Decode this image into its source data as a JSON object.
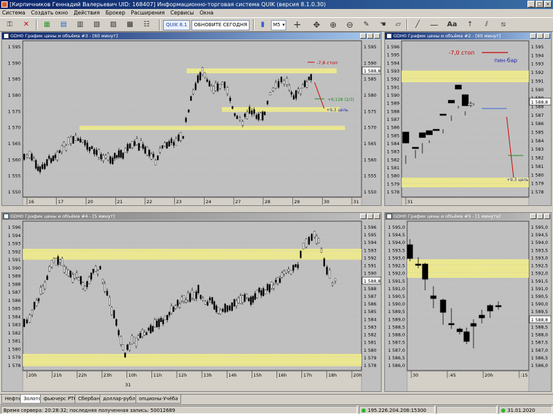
{
  "window": {
    "title": "[Кирпичников Геннадий Валерьевич UID: 168407] Информационно-торговая система QUIK (версия 8.1.0.30)"
  },
  "menu": [
    "Система",
    "Создать окно",
    "Действия",
    "Брокер",
    "Расширения",
    "Сервисы",
    "Окна"
  ],
  "toolbar": {
    "quik_label": "QUIK 8.1",
    "update_label": "ОБНОВИТЕ СЕГОДНЯ",
    "interval": "M5",
    "font_label": "Aa"
  },
  "colors": {
    "candle_up": "#ffffff",
    "candle_down": "#000000",
    "zone": "#f0eb8c",
    "stop": "#cc0000",
    "target": "#228822",
    "buy_line": "#3366cc"
  },
  "charts": [
    {
      "title": "GDH0 График цены и объёма #3 - [60 минут]",
      "yticks": [
        "1 595",
        "1 590",
        "1 585",
        "1 580",
        "1 575",
        "1 570",
        "1 565",
        "1 560",
        "1 555",
        "1 550"
      ],
      "yticks_right": [
        "1 595",
        "1 590",
        "1 585",
        "1 580",
        "1 575",
        "1 570",
        "1 565",
        "1 560",
        "1 555",
        "1 550"
      ],
      "last_price": "1 588,8",
      "xticks": [
        "16",
        "17",
        "20",
        "21",
        "22",
        "23",
        "24",
        "27",
        "28",
        "29",
        "30",
        "31"
      ],
      "annotations": {
        "stop": "-7,8 стоп",
        "target1": "+6,128 (2/3)",
        "target2": "+9,3 цель"
      }
    },
    {
      "title": "GDH0 График цены и объёма #2 - [60 минут]",
      "yticks": [
        "1 596",
        "1 595",
        "1 594",
        "1 593",
        "1 592",
        "1 591",
        "1 590",
        "1 589",
        "1 588",
        "1 587",
        "1 586",
        "1 585",
        "1 584",
        "1 583",
        "1 582",
        "1 581",
        "1 580",
        "1 579",
        "1 578"
      ],
      "yticks_right": [
        "1 595",
        "1 594",
        "1 593",
        "1 592",
        "1 591",
        "1 590",
        "1 589",
        "1 588",
        "1 587",
        "1 586",
        "1 585",
        "1 584",
        "1 583",
        "1 582",
        "1 581",
        "1 580",
        "1 579",
        "1 578"
      ],
      "last_price": "1 588,8",
      "xticks": [
        "31"
      ],
      "annotations": {
        "stop": "-7,0 стоп",
        "pinbar": "пин-бар",
        "target": "+9,3 цель"
      }
    },
    {
      "title": "GDH0 График цены и объёма #4 - [5 минут]",
      "yticks": [
        "1 596",
        "1 594",
        "1 593",
        "1 592",
        "1 591",
        "1 590",
        "1 589",
        "1 588",
        "1 587",
        "1 586",
        "1 585",
        "1 584",
        "1 583",
        "1 582",
        "1 581",
        "1 580",
        "1 579",
        "1 578"
      ],
      "yticks_right": [
        "1 596",
        "1 595",
        "1 594",
        "1 593",
        "1 592",
        "1 591",
        "1 590",
        "1 589",
        "1 588",
        "1 587",
        "1 586",
        "1 585",
        "1 584",
        "1 583",
        "1 582",
        "1 581",
        "1 580",
        "1 579",
        "1 578"
      ],
      "last_price": "1 588,8",
      "xticks": [
        "20h",
        "21h",
        "22h",
        "23h",
        "10h",
        "11h",
        "12h",
        "13h",
        "14h",
        "15h",
        "16h",
        "17h",
        "18h",
        "20h"
      ],
      "xdate": "31"
    },
    {
      "title": "GDH0 График цены и объёма #5 - [1 минута]",
      "yticks": [
        "1 595,0",
        "1 594,5",
        "1 594,0",
        "1 593,5",
        "1 593,0",
        "1 592,5",
        "1 592,0",
        "1 591,5",
        "1 591,0",
        "1 590,5",
        "1 590,0",
        "1 589,5",
        "1 589,0",
        "1 588,5",
        "1 588,0",
        "1 587,5",
        "1 587,0",
        "1 586,5",
        "1 586,0"
      ],
      "yticks_right": [
        "1 595,0",
        "1 594,5",
        "1 594,0",
        "1 593,5",
        "1 593,0",
        "1 592,5",
        "1 592,0",
        "1 591,5",
        "1 591,0",
        "1 590,5",
        "1 590,0",
        "1 589,5",
        "1 589,0",
        "1 588,5",
        "1 588,0",
        "1 587,5",
        "1 587,0",
        "1 586,5",
        "1 586,0"
      ],
      "last_price": "1 588,8",
      "xticks": [
        "30",
        ":45",
        "20h",
        ":15"
      ]
    }
  ],
  "tabs": [
    "Нефть",
    "Золото",
    "фьючерс РТС",
    "Сбербанк",
    "доллар-рубль",
    "опционы-Учёба"
  ],
  "active_tab": "Золото",
  "status": {
    "server_time": "Время сервера: 20:28:32; последняя полученная запись: 50012689",
    "connection": "195.226.204.208:15300",
    "date": "31.01.2020"
  }
}
